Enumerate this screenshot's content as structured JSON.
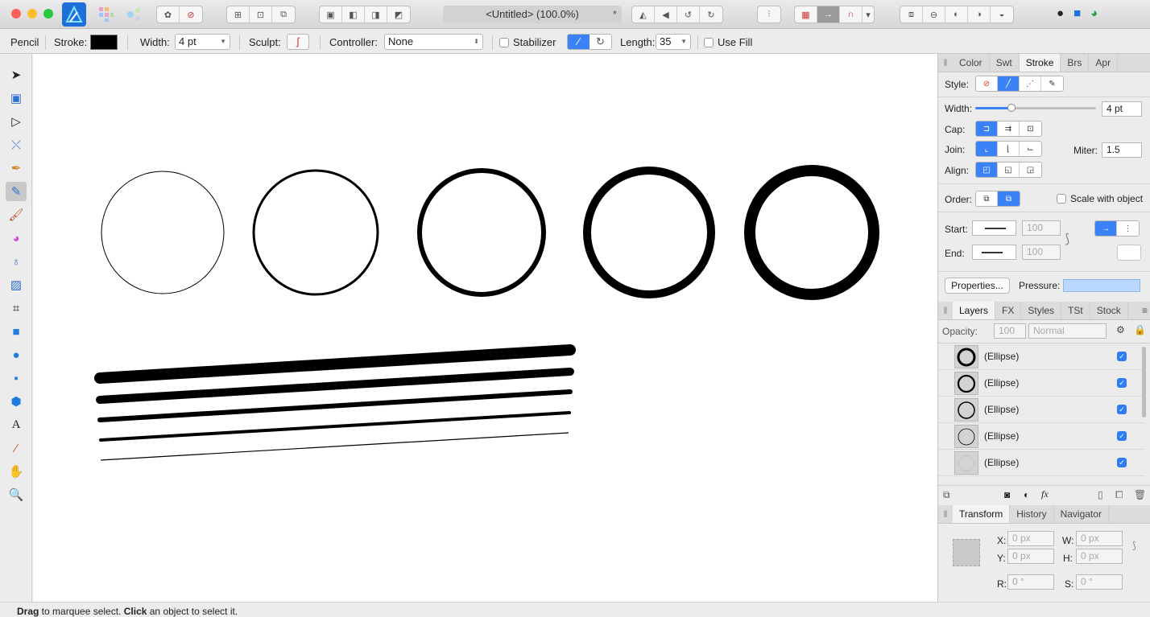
{
  "app": {
    "doc_title": "<Untitled> (100.0%)",
    "dirty_mark": "*"
  },
  "context": {
    "tool_name": "Pencil",
    "stroke_label": "Stroke:",
    "width_label": "Width:",
    "width_value": "4 pt",
    "sculpt_label": "Sculpt:",
    "controller_label": "Controller:",
    "controller_value": "None",
    "stabilizer_label": "Stabilizer",
    "length_label": "Length:",
    "length_value": "35",
    "usefill_label": "Use Fill"
  },
  "stroke_panel": {
    "tabs": [
      "Color",
      "Swt",
      "Stroke",
      "Brs",
      "Apr"
    ],
    "style_label": "Style:",
    "width_label": "Width:",
    "width_value": "4 pt",
    "width_fraction": 0.3,
    "cap_label": "Cap:",
    "join_label": "Join:",
    "miter_label": "Miter:",
    "miter_value": "1.5",
    "align_label": "Align:",
    "order_label": "Order:",
    "scale_label": "Scale with object",
    "start_label": "Start:",
    "start_value": "100",
    "end_label": "End:",
    "end_value": "100",
    "properties_label": "Properties...",
    "pressure_label": "Pressure:"
  },
  "layers_panel": {
    "tabs": [
      "Layers",
      "FX",
      "Styles",
      "TSt",
      "Stock"
    ],
    "opacity_label": "Opacity:",
    "opacity_value": "100",
    "blend_value": "Normal",
    "items": [
      {
        "name": "(Ellipse)"
      },
      {
        "name": "(Ellipse)"
      },
      {
        "name": "(Ellipse)"
      },
      {
        "name": "(Ellipse)"
      },
      {
        "name": "(Ellipse)"
      }
    ]
  },
  "transform_panel": {
    "tabs": [
      "Transform",
      "History",
      "Navigator"
    ],
    "x_label": "X:",
    "x_value": "0 px",
    "w_label": "W:",
    "w_value": "0 px",
    "y_label": "Y:",
    "y_value": "0 px",
    "h_label": "H:",
    "h_value": "0 px",
    "r_label": "R:",
    "r_value": "0 °",
    "s_label": "S:",
    "s_value": "0 °"
  },
  "status": {
    "bold1": "Drag",
    "text1": " to marquee select. ",
    "bold2": "Click",
    "text2": " an object to select it."
  },
  "colors": {
    "accent": "#3b82f6",
    "stroke_swatch": "#000000",
    "pressure": "#b8d8ff"
  }
}
